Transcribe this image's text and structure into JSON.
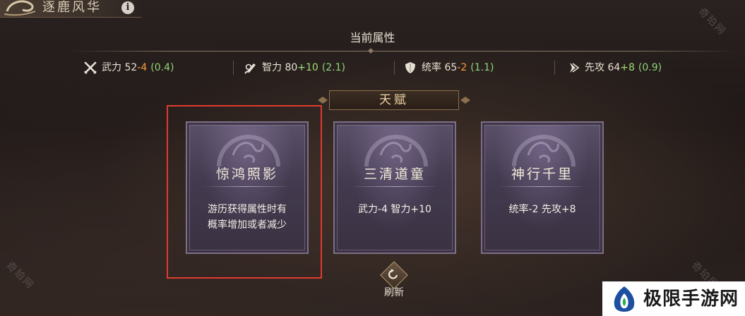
{
  "header": {
    "title": "逐鹿风华",
    "info_label": "i"
  },
  "section_title": "当前属性",
  "stats": [
    {
      "icon": "crossed-swords-icon",
      "label": "武力",
      "base": "52",
      "delta": "-4",
      "extra": "(0.4)"
    },
    {
      "icon": "brain-quill-icon",
      "label": "智力",
      "base": "80",
      "delta": "+10",
      "extra": "(2.1)"
    },
    {
      "icon": "shield-icon",
      "label": "统率",
      "base": "65",
      "delta": "-2",
      "extra": "(1.1)"
    },
    {
      "icon": "boot-arrow-icon",
      "label": "先攻",
      "base": "64",
      "delta": "+8",
      "extra": "(0.9)"
    }
  ],
  "talent_tab": {
    "label": "天赋"
  },
  "cards": [
    {
      "name": "惊鸿照影",
      "desc_line1": "游历获得属性时有",
      "desc_line2": "概率增加或者减少",
      "selected": true
    },
    {
      "name": "三清道童",
      "desc_line1": "武力-4  智力+10",
      "desc_line2": "",
      "selected": false
    },
    {
      "name": "神行千里",
      "desc_line1": "统率-2  先攻+8",
      "desc_line2": "",
      "selected": false
    }
  ],
  "refresh": {
    "label": "刷新"
  },
  "watermark": "奇珀网",
  "logo": {
    "text": "极限手游网"
  },
  "colors": {
    "negative_delta": "#ff9a3c",
    "positive_delta": "#9fdc76",
    "selection": "#e03a2f"
  }
}
